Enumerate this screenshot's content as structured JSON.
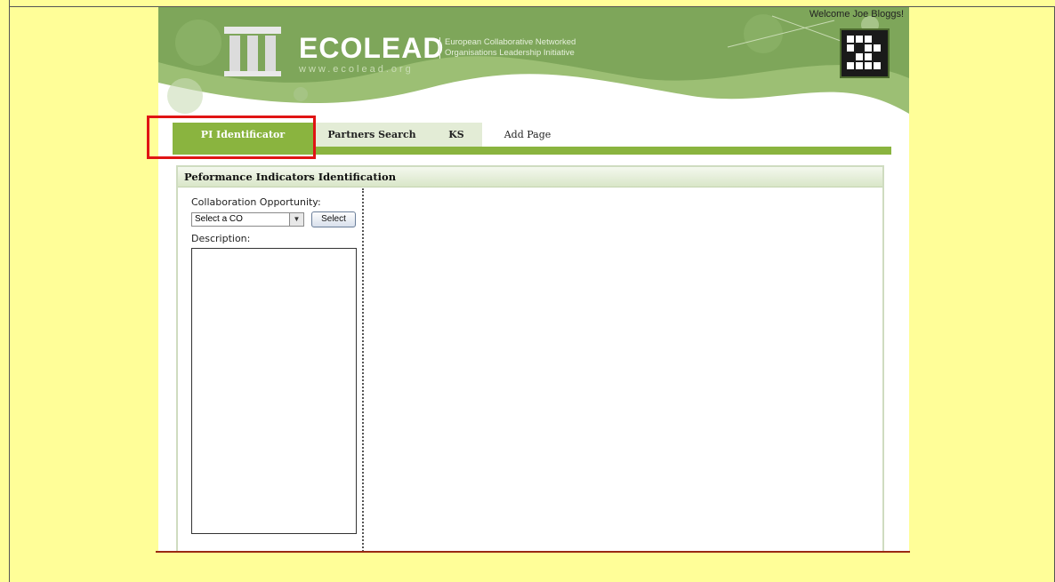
{
  "header": {
    "logo_text": "ECOLEAD",
    "logo_url": "www.ecolead.org",
    "tagline_1": "European Collaborative Networked",
    "tagline_2": "Organisations Leadership Initiative",
    "welcome": "Welcome Joe Bloggs!"
  },
  "tabs": [
    {
      "label": "PI Identificator",
      "active": true
    },
    {
      "label": "Partners Search"
    },
    {
      "label": "KS"
    },
    {
      "label": "Add Page"
    }
  ],
  "panel": {
    "title": "Peformance Indicators Identification",
    "co_label": "Collaboration Opportunity:",
    "co_select_value": "Select a CO",
    "select_button": "Select",
    "description_label": "Description:",
    "description_value": ""
  },
  "colors": {
    "page_background": "#fffe98",
    "accent_green": "#8ab43f",
    "highlight_red": "#e01414"
  }
}
